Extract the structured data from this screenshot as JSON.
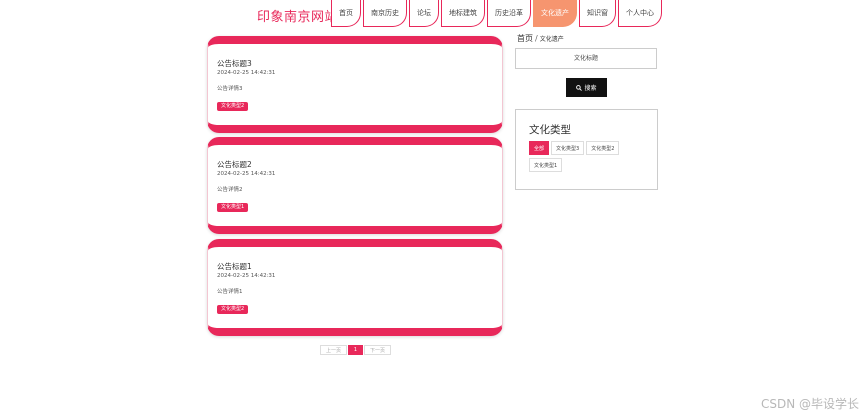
{
  "header": {
    "site_title": "印象南京网站",
    "nav": [
      {
        "label": "首页",
        "active": false
      },
      {
        "label": "南京历史",
        "active": false
      },
      {
        "label": "论坛",
        "active": false
      },
      {
        "label": "地标建筑",
        "active": false
      },
      {
        "label": "历史沿革",
        "active": false
      },
      {
        "label": "文化遗产",
        "active": true
      },
      {
        "label": "知识窗",
        "active": false
      },
      {
        "label": "个人中心",
        "active": false
      }
    ]
  },
  "cards": [
    {
      "title": "公告标题3",
      "date": "2024-02-25 14:42:31",
      "detail": "公告详情3",
      "badge": "文化类型2"
    },
    {
      "title": "公告标题2",
      "date": "2024-02-25 14:42:31",
      "detail": "公告详情2",
      "badge": "文化类型1"
    },
    {
      "title": "公告标题1",
      "date": "2024-02-25 14:42:31",
      "detail": "公告详情1",
      "badge": "文化类型2"
    }
  ],
  "pagination": {
    "prev": "上一页",
    "current": "1",
    "next": "下一页"
  },
  "sidebar": {
    "breadcrumb_home": "首页",
    "breadcrumb_sep": "/",
    "breadcrumb_current": "文化遗产",
    "search_placeholder": "文化标题",
    "search_button": "搜索",
    "type_title": "文化类型",
    "types": [
      {
        "label": "全部",
        "active": true
      },
      {
        "label": "文化类型3",
        "active": false
      },
      {
        "label": "文化类型2",
        "active": false
      },
      {
        "label": "文化类型1",
        "active": false
      }
    ]
  },
  "watermark": "CSDN @毕设学长",
  "colors": {
    "accent": "#e8285a",
    "active_nav": "#f6956f",
    "search_button": "#111111"
  }
}
